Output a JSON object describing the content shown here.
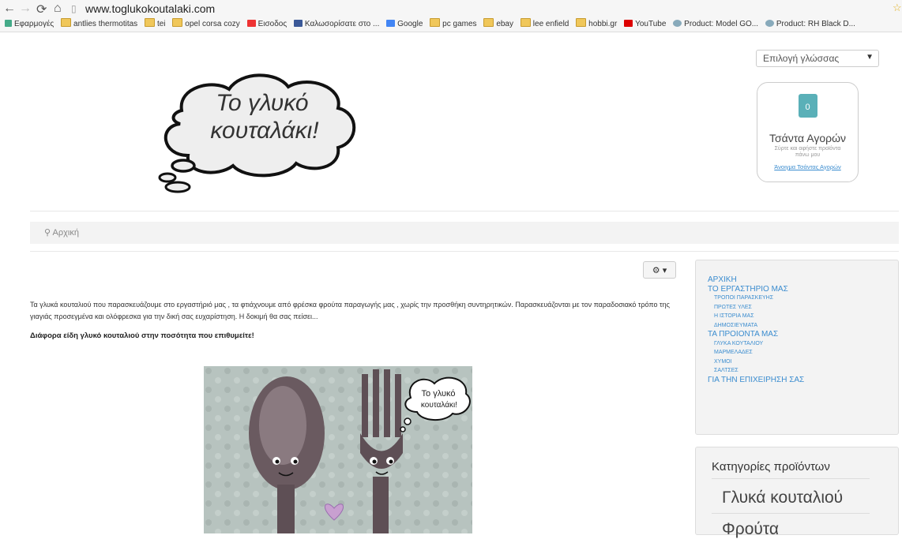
{
  "browser": {
    "url": "www.toglukokoutalaki.com",
    "bookmarks": [
      "Εφαρμογές",
      "antlies thermotitas",
      "tei",
      "opel corsa cozy",
      "Εισοδος",
      "Καλωσορίσατε στο ...",
      "Google",
      "pc games",
      "ebay",
      "lee enfield",
      "hobbi.gr",
      "YouTube",
      "Product: Model GO...",
      "Product: RH Black D..."
    ]
  },
  "header": {
    "logo_line1": "Το γλυκό",
    "logo_line2": "κουταλάκι!",
    "language_select": "Επιλογή γλώσσας",
    "bag": {
      "count": "0",
      "title": "Τσάντα Αγορών",
      "subtitle": "Σύρτε και αφήστε προϊόντα πάνω μου",
      "link": "Άνοιγμα Τσάντας Αγορών"
    }
  },
  "breadcrumb": {
    "home": "Αρχική"
  },
  "main": {
    "intro": "Τα γλυκά κουταλιού που παρασκευάζουμε στο εργαστήριό μας , τα φτιάχνουμε από φρέσκα φρούτα παραγωγής μας , χωρίς την προσθήκη συντηρητικών.  Παρασκευάζονται με τον παραδοσιακό τρόπο της γιαγιάς προσεγμένα και ολόφρεσκα για την δική σας ευχαρίστηση. Η δοκιμή θα σας πείσει...",
    "bold_line": "Διάφορα είδη γλυκό κουταλιού στην ποσότητα που επιθυμείτε!",
    "photo_bubble_line1": "Το γλυκό",
    "photo_bubble_line2": "κουταλάκι!"
  },
  "side_menu": {
    "items": [
      {
        "label": "ΑΡΧΙΚΗ",
        "level": 1
      },
      {
        "label": "ΤΟ ΕΡΓΑΣΤΗΡΙΟ ΜΑΣ",
        "level": 1
      },
      {
        "label": "ΤΡΟΠΟΙ ΠΑΡΑΣΚΕΥΗΣ",
        "level": 2
      },
      {
        "label": "ΠΡΩΤΕΣ ΥΛΕΣ",
        "level": 2
      },
      {
        "label": "Η ΙΣΤΟΡΙΑ ΜΑΣ",
        "level": 2
      },
      {
        "label": "ΔΗΜΟΣΙΕΥΜΑΤΑ",
        "level": 2
      },
      {
        "label": "ΤΑ ΠΡΟΙΟΝΤΑ ΜΑΣ",
        "level": 1
      },
      {
        "label": "ΓΛΥΚΑ ΚΟΥΤΑΛΙΟΥ",
        "level": 2
      },
      {
        "label": "ΜΑΡΜΕΛΑΔΕΣ",
        "level": 2
      },
      {
        "label": "ΧΥΜΟΙ",
        "level": 2
      },
      {
        "label": "ΣΑΛΤΣΕΣ",
        "level": 2
      },
      {
        "label": "ΓΙΑ ΤΗΝ ΕΠΙΧΕΙΡΗΣΗ ΣΑΣ",
        "level": 1
      }
    ]
  },
  "categories": {
    "title": "Κατηγορίες προϊόντων",
    "items": [
      "Γλυκά κουταλιού",
      "Φρούτα"
    ]
  },
  "colors": {
    "link": "#3a8ccf",
    "panel": "#f3f3f3",
    "bag_accent": "#5ab0b8"
  }
}
